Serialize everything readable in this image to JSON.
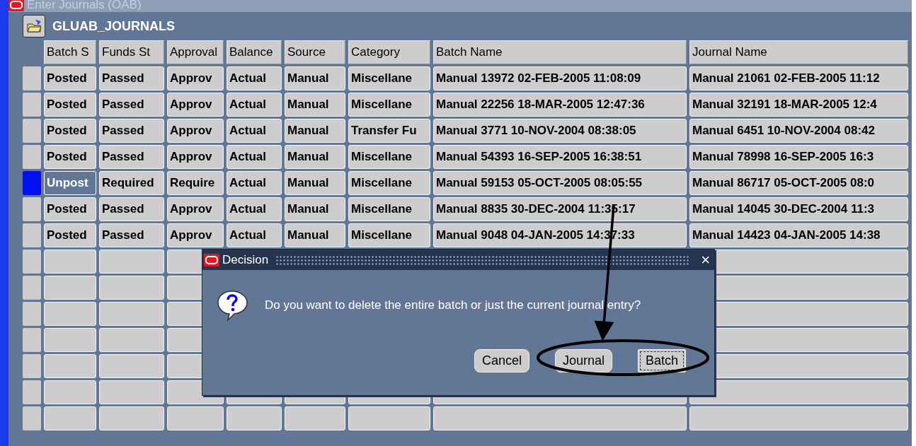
{
  "window": {
    "title": "Enter Journals (OAB)"
  },
  "form": {
    "title": "GLUAB_JOURNALS"
  },
  "table": {
    "columns": [
      "Batch S",
      "Funds St",
      "Approval",
      "Balance",
      "Source",
      "Category",
      "Batch Name",
      "Journal Name"
    ],
    "rows": [
      {
        "selected": false,
        "cells": [
          "Posted",
          "Passed",
          "Approv",
          "Actual",
          "Manual",
          "Miscellane",
          "Manual 13972 02-FEB-2005 11:08:09",
          "Manual 21061 02-FEB-2005 11:12"
        ]
      },
      {
        "selected": false,
        "cells": [
          "Posted",
          "Passed",
          "Approv",
          "Actual",
          "Manual",
          "Miscellane",
          "Manual 22256 18-MAR-2005 12:47:36",
          "Manual 32191 18-MAR-2005 12:4"
        ]
      },
      {
        "selected": false,
        "cells": [
          "Posted",
          "Passed",
          "Approv",
          "Actual",
          "Manual",
          "Transfer Fu",
          "Manual 3771 10-NOV-2004 08:38:05",
          "Manual 6451 10-NOV-2004 08:42"
        ]
      },
      {
        "selected": false,
        "cells": [
          "Posted",
          "Passed",
          "Approv",
          "Actual",
          "Manual",
          "Miscellane",
          "Manual 54393 16-SEP-2005 16:38:51",
          "Manual 78998 16-SEP-2005 16:3"
        ]
      },
      {
        "selected": true,
        "cells": [
          "Unpost",
          "Required",
          "Require",
          "Actual",
          "Manual",
          "Miscellane",
          "Manual 59153 05-OCT-2005 08:05:55",
          "Manual 86717 05-OCT-2005 08:0"
        ]
      },
      {
        "selected": false,
        "cells": [
          "Posted",
          "Passed",
          "Approv",
          "Actual",
          "Manual",
          "Miscellane",
          "Manual 8835 30-DEC-2004 11:35:17",
          "Manual 14045 30-DEC-2004 11:3"
        ]
      },
      {
        "selected": false,
        "cells": [
          "Posted",
          "Passed",
          "Approv",
          "Actual",
          "Manual",
          "Miscellane",
          "Manual 9048 04-JAN-2005 14:37:33",
          "Manual 14423 04-JAN-2005 14:38"
        ]
      }
    ]
  },
  "dialog": {
    "title": "Decision",
    "message": "Do you want to delete the entire batch or just the current journal entry?",
    "close": "×",
    "buttons": [
      {
        "label": "Cancel",
        "focused": false
      },
      {
        "label": "Journal",
        "focused": false
      },
      {
        "label": "Batch",
        "focused": true
      }
    ]
  }
}
